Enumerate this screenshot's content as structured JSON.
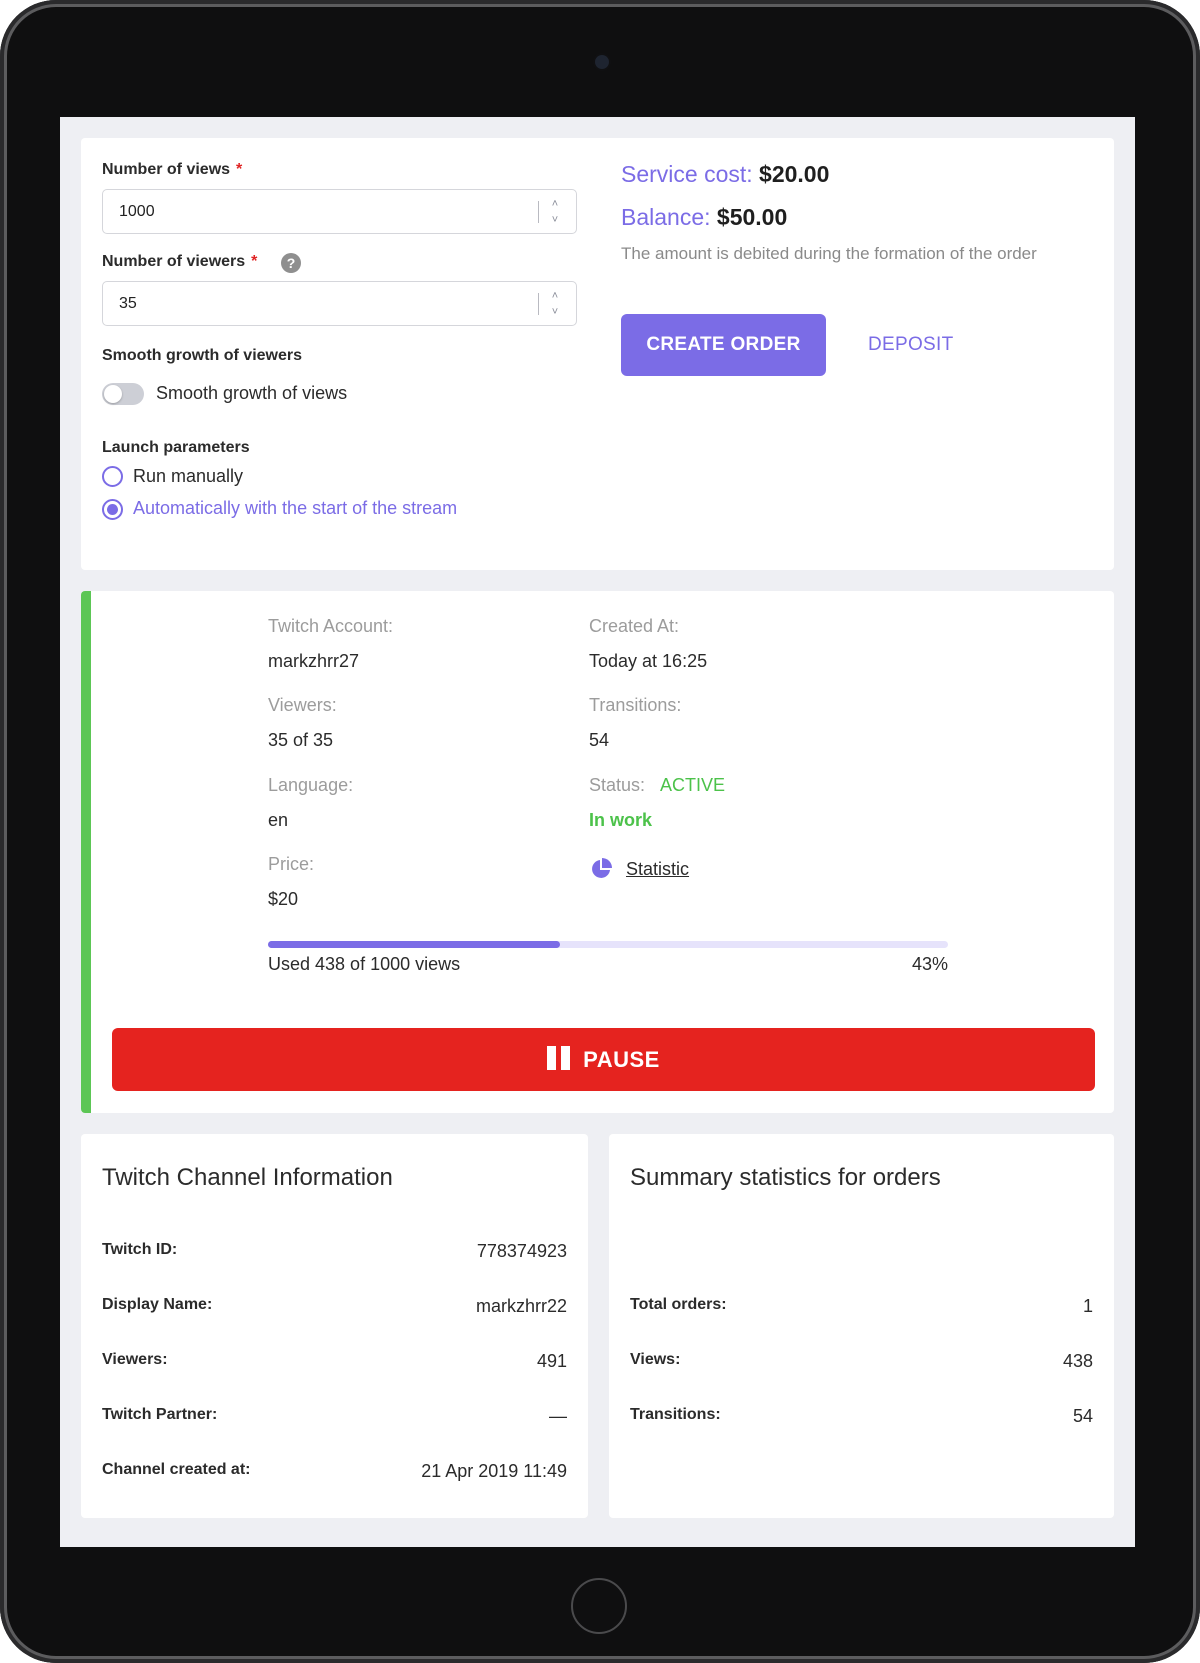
{
  "form": {
    "views_label": "Number of views",
    "required_mark": "*",
    "views_value": "1000",
    "viewers_label": "Number of viewers",
    "help_glyph": "?",
    "viewers_value": "35",
    "smooth_label": "Smooth growth of viewers",
    "smooth_toggle_text": "Smooth growth of views",
    "smooth_toggle_on": false,
    "launch_label": "Launch parameters",
    "launch_options": [
      {
        "label": "Run manually",
        "selected": false
      },
      {
        "label": "Automatically with the start of the stream",
        "selected": true
      }
    ]
  },
  "summary": {
    "service_cost_label": "Service cost:",
    "service_cost_value": "$20.00",
    "balance_label": "Balance:",
    "balance_value": "$50.00",
    "note": "The amount is debited during the formation of the order",
    "create_button": "CREATE ORDER",
    "deposit_button": "DEPOSIT"
  },
  "order": {
    "account_label": "Twitch Account:",
    "account_value": "markzhrr27",
    "created_label": "Created At:",
    "created_value": "Today at 16:25",
    "viewers_label": "Viewers:",
    "viewers_value": "35 of 35",
    "transitions_label": "Transitions:",
    "transitions_value": "54",
    "language_label": "Language:",
    "language_value": "en",
    "status_label": "Status:",
    "status_value": "ACTIVE",
    "status_detail": "In work",
    "price_label": "Price:",
    "price_value": "$20",
    "statistic_link": "Statistic",
    "progress_text": "Used 438 of 1000 views",
    "progress_percent_text": "43%",
    "progress_fraction": 0.43,
    "pause_button": "PAUSE"
  },
  "channel_info": {
    "title": "Twitch Channel Information",
    "rows": [
      {
        "key": "Twitch ID:",
        "value": "778374923"
      },
      {
        "key": "Display Name:",
        "value": "markzhrr22"
      },
      {
        "key": "Viewers:",
        "value": "491"
      },
      {
        "key": "Twitch Partner:",
        "value": "—"
      },
      {
        "key": "Channel created at:",
        "value": "21 Apr 2019 11:49"
      }
    ]
  },
  "order_stats": {
    "title": "Summary statistics for orders",
    "rows": [
      {
        "key": "Total orders:",
        "value": "1"
      },
      {
        "key": "Views:",
        "value": "438"
      },
      {
        "key": "Transitions:",
        "value": "54"
      }
    ]
  },
  "colors": {
    "accent": "#7b6ce6",
    "active_green": "#4cc24a",
    "card_border_green": "#5cc655",
    "pause_red": "#e5231f",
    "required_red": "#e02424"
  },
  "icons": {
    "help": "question-circle-icon",
    "statistic": "pie-chart-icon",
    "pause": "pause-icon",
    "spinner": "chevron-up-down-icon"
  }
}
